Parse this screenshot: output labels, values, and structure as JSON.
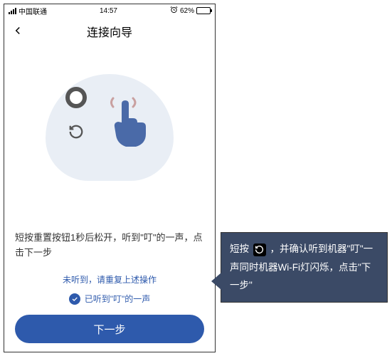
{
  "status": {
    "carrier": "中国联通",
    "time": "14:57",
    "alarm_icon": "alarm",
    "battery_pct": "62%"
  },
  "nav": {
    "title": "连接向导",
    "back_icon": "back-chevron"
  },
  "instruction": "短按重置按钮1秒后松开，听到\"叮\"的一声，点击下一步",
  "hint_link": "未听到，请重复上述操作",
  "check_label": "已听到\"叮\"的一声",
  "next_btn": "下一步",
  "tooltip": {
    "pre": "短按",
    "post": "，并确认听到机器\"叮\"一声同时机器Wi-Fi灯闪烁，点击\"下一步\""
  },
  "colors": {
    "accent": "#2e5aac",
    "tooltip_bg": "#3b4a66"
  }
}
